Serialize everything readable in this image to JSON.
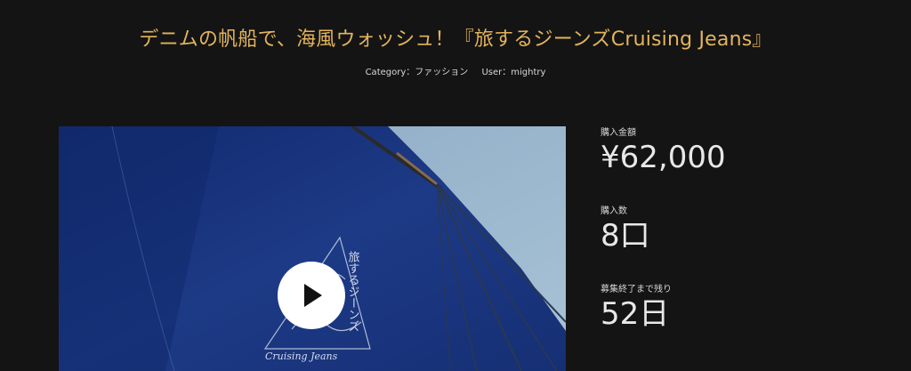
{
  "project": {
    "title": "デニムの帆船で、海風ウォッシュ！『旅するジーンズCruising Jeans』",
    "category_label": "Category：ファッション",
    "user_label": "User：mightry"
  },
  "video": {
    "logo_title": "旅するジーンズ",
    "logo_subtitle": "Cruising Jeans",
    "play_icon": "play-icon"
  },
  "stats": [
    {
      "label": "購入金額",
      "value": "¥62,000"
    },
    {
      "label": "購入数",
      "value": "8口"
    },
    {
      "label": "募集終了まで残り",
      "value": "52日"
    }
  ]
}
